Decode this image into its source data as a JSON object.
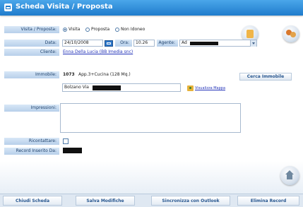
{
  "titlebar": {
    "title": "Scheda Visita / Proposta"
  },
  "labels": {
    "tipo": "Visita / Proposta:",
    "data": "Data:",
    "ora": "Ora:",
    "agente": "Agente:",
    "cliente": "Cliente:",
    "immobile": "Immobile:",
    "impressioni": "Impressioni:",
    "ricontattare": "Ricontattare:",
    "record_inserito": "Record Inserito Da:"
  },
  "tipo_options": [
    {
      "label": "Visita",
      "selected": true
    },
    {
      "label": "Proposta",
      "selected": false
    },
    {
      "label": "Non Idoneo",
      "selected": false
    }
  ],
  "values": {
    "data": "24/10/2008",
    "ora": "10.26",
    "agente": "Ad",
    "cliente": "Enna Della Lucia (BB Imedia snc)",
    "immobile_code": "1073",
    "immobile_desc": "App.3+Cucina (128 Mq.)",
    "address": "Bolzano Via",
    "impressioni": "",
    "ricontattare": false
  },
  "buttons": {
    "cerca_immobile": "Cerca Immobile",
    "visualizza_mappa": "Visualizza Mappa",
    "chiudi": "Chiudi Scheda",
    "salva": "Salva Modifiche",
    "sincronizza": "Sincronizza con Outlook",
    "elimina": "Elimina Record"
  },
  "colors": {
    "titlebar": "#1f7ccc",
    "label_bg": "#c8dbf1",
    "button_text": "#27568f",
    "link": "#2232b8"
  },
  "icons": [
    "form-icon",
    "report-icon",
    "users-icon",
    "calendar-icon",
    "map-icon",
    "home-icon",
    "dropdown-icon"
  ]
}
